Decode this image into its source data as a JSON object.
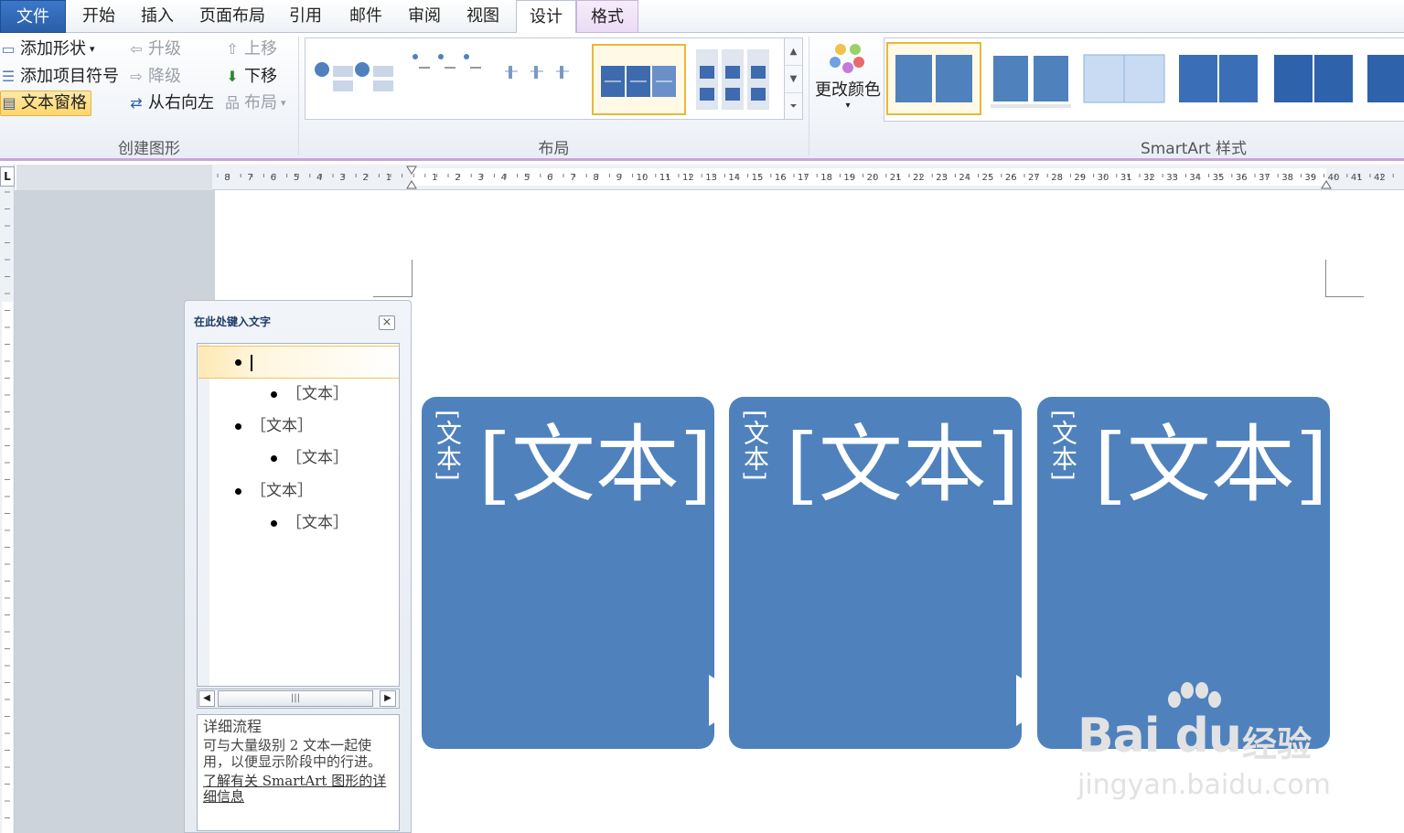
{
  "tabs": {
    "file": "文件",
    "home": "开始",
    "insert": "插入",
    "page_layout": "页面布局",
    "references": "引用",
    "mailings": "邮件",
    "review": "审阅",
    "view": "视图",
    "design": "设计",
    "format": "格式"
  },
  "create_graphic": {
    "group_label": "创建图形",
    "add_shape": "添加形状",
    "add_bullet": "添加项目符号",
    "text_pane": "文本窗格",
    "promote": "升级",
    "demote": "降级",
    "move_up": "上移",
    "move_down": "下移",
    "right_to_left": "从右向左",
    "layout": "布局"
  },
  "layouts": {
    "group_label": "布局"
  },
  "smartart_styles": {
    "change_colors": "更改颜色",
    "group_label": "SmartArt 样式"
  },
  "ruler": {
    "corner": "L",
    "left_ticks": [
      "8",
      "7",
      "6",
      "5",
      "4",
      "3",
      "2",
      "1"
    ],
    "right_ticks": [
      "1",
      "2",
      "3",
      "4",
      "5",
      "6",
      "7",
      "8",
      "9",
      "10",
      "11",
      "12",
      "13",
      "14",
      "15",
      "16",
      "17",
      "18",
      "19",
      "20",
      "21",
      "22",
      "23",
      "24",
      "25",
      "26",
      "27",
      "28",
      "29",
      "30",
      "31",
      "32",
      "33",
      "34",
      "35",
      "36",
      "37",
      "38",
      "39",
      "40",
      "41",
      "42"
    ]
  },
  "text_pane": {
    "title": "在此处键入文字",
    "items": [
      {
        "level": 1,
        "text": ""
      },
      {
        "level": 2,
        "text": "［文本］"
      },
      {
        "level": 1,
        "text": "［文本］"
      },
      {
        "level": 2,
        "text": "［文本］"
      },
      {
        "level": 1,
        "text": "［文本］"
      },
      {
        "level": 2,
        "text": "［文本］"
      }
    ],
    "desc_title": "详细流程",
    "desc_body": "可与大量级别 2 文本一起使用，以便显示阶段中的行进。",
    "desc_link": "了解有关 SmartArt 图形的详细信息"
  },
  "smartart": {
    "boxes": [
      {
        "vertical_text": "[文本]",
        "main_text": "[文本]"
      },
      {
        "vertical_text": "[文本]",
        "main_text": "[文本]"
      },
      {
        "vertical_text": "[文本]",
        "main_text": "[文本]"
      }
    ],
    "fill_color": "#4f81bd"
  },
  "watermark": {
    "logo": "Bai du",
    "cn": "经验",
    "url": "jingyan.baidu.com"
  }
}
